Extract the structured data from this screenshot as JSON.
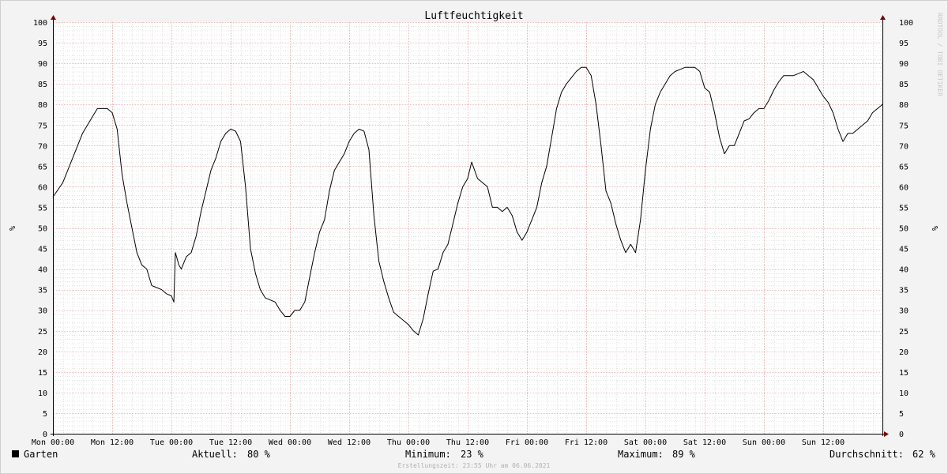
{
  "chart_data": {
    "type": "line",
    "title": "Luftfeuchtigkeit",
    "ylabel": "%",
    "ylim": [
      0,
      100
    ],
    "y_ticks": [
      0,
      5,
      10,
      15,
      20,
      25,
      30,
      35,
      40,
      45,
      50,
      55,
      60,
      65,
      70,
      75,
      80,
      85,
      90,
      95,
      100
    ],
    "x_ticks": [
      "Mon 00:00",
      "Mon 12:00",
      "Tue 00:00",
      "Tue 12:00",
      "Wed 00:00",
      "Wed 12:00",
      "Thu 00:00",
      "Thu 12:00",
      "Fri 00:00",
      "Fri 12:00",
      "Sat 00:00",
      "Sat 12:00",
      "Sun 00:00",
      "Sun 12:00"
    ],
    "x_unit": "hours since Mon 00:00",
    "xlim": [
      0,
      168
    ],
    "grid": true,
    "watermark": "RRDTOOL / TOBI OETIKER",
    "series": [
      {
        "name": "Garten",
        "color": "#000000",
        "points": [
          [
            0,
            57.5
          ],
          [
            2,
            61
          ],
          [
            4,
            67
          ],
          [
            6,
            73
          ],
          [
            8,
            77
          ],
          [
            9,
            79
          ],
          [
            10,
            79
          ],
          [
            11,
            79
          ],
          [
            12,
            78
          ],
          [
            13,
            74
          ],
          [
            14,
            63
          ],
          [
            15,
            56
          ],
          [
            16,
            50
          ],
          [
            17,
            44
          ],
          [
            18,
            41
          ],
          [
            19,
            40
          ],
          [
            20,
            36
          ],
          [
            21,
            35.5
          ],
          [
            22,
            35
          ],
          [
            23,
            34
          ],
          [
            24,
            33.5
          ],
          [
            24.5,
            32
          ],
          [
            24.8,
            44
          ],
          [
            25.5,
            41
          ],
          [
            26,
            40
          ],
          [
            27,
            43
          ],
          [
            28,
            44
          ],
          [
            29,
            48
          ],
          [
            30,
            54
          ],
          [
            31,
            59
          ],
          [
            32,
            64
          ],
          [
            33,
            67
          ],
          [
            34,
            71
          ],
          [
            35,
            73
          ],
          [
            36,
            74
          ],
          [
            37,
            73.5
          ],
          [
            38,
            71
          ],
          [
            39,
            60
          ],
          [
            40,
            45
          ],
          [
            41,
            39
          ],
          [
            42,
            35
          ],
          [
            43,
            33
          ],
          [
            44,
            32.5
          ],
          [
            45,
            32
          ],
          [
            46,
            30
          ],
          [
            47,
            28.5
          ],
          [
            48,
            28.5
          ],
          [
            49,
            30
          ],
          [
            50,
            30
          ],
          [
            51,
            32
          ],
          [
            52,
            38
          ],
          [
            53,
            44
          ],
          [
            54,
            49
          ],
          [
            55,
            52
          ],
          [
            56,
            59
          ],
          [
            57,
            64
          ],
          [
            58,
            66
          ],
          [
            59,
            68
          ],
          [
            60,
            71
          ],
          [
            61,
            73
          ],
          [
            62,
            74
          ],
          [
            63,
            73.5
          ],
          [
            64,
            69
          ],
          [
            65,
            53
          ],
          [
            66,
            42
          ],
          [
            67,
            37
          ],
          [
            68,
            33
          ],
          [
            69,
            29.5
          ],
          [
            70,
            28.5
          ],
          [
            71,
            27.5
          ],
          [
            72,
            26.5
          ],
          [
            73,
            25
          ],
          [
            74,
            24
          ],
          [
            75,
            28
          ],
          [
            76,
            34
          ],
          [
            77,
            39.5
          ],
          [
            78,
            40
          ],
          [
            79,
            44
          ],
          [
            80,
            46
          ],
          [
            81,
            51
          ],
          [
            82,
            56
          ],
          [
            83,
            60
          ],
          [
            84,
            62
          ],
          [
            84.8,
            66
          ],
          [
            86,
            62
          ],
          [
            88,
            60
          ],
          [
            89,
            55
          ],
          [
            90,
            55
          ],
          [
            91,
            54
          ],
          [
            92,
            55
          ],
          [
            93,
            53
          ],
          [
            94,
            49
          ],
          [
            95,
            47
          ],
          [
            96,
            49
          ],
          [
            97,
            52
          ],
          [
            98,
            55
          ],
          [
            99,
            61
          ],
          [
            100,
            65
          ],
          [
            101,
            72
          ],
          [
            102,
            79
          ],
          [
            103,
            83
          ],
          [
            104,
            85
          ],
          [
            105,
            86.5
          ],
          [
            106,
            88
          ],
          [
            107,
            89
          ],
          [
            108,
            89
          ],
          [
            109,
            87
          ],
          [
            110,
            80
          ],
          [
            111,
            70
          ],
          [
            112,
            59
          ],
          [
            113,
            56
          ],
          [
            114,
            51
          ],
          [
            115,
            47
          ],
          [
            116,
            44
          ],
          [
            117,
            46
          ],
          [
            118,
            44
          ],
          [
            119,
            52
          ],
          [
            120,
            64
          ],
          [
            121,
            74
          ],
          [
            122,
            80
          ],
          [
            123,
            83
          ],
          [
            124,
            85
          ],
          [
            125,
            87
          ],
          [
            126,
            88
          ],
          [
            127,
            88.5
          ],
          [
            128,
            89
          ],
          [
            129,
            89
          ],
          [
            130,
            89
          ],
          [
            131,
            88
          ],
          [
            132,
            84
          ],
          [
            133,
            83
          ],
          [
            134,
            78
          ],
          [
            135,
            72
          ],
          [
            136,
            68
          ],
          [
            137,
            70
          ],
          [
            138,
            70
          ],
          [
            139,
            73
          ],
          [
            140,
            76
          ],
          [
            141,
            76.5
          ],
          [
            142,
            78
          ],
          [
            143,
            79
          ],
          [
            144,
            79
          ],
          [
            145,
            81
          ],
          [
            146,
            83.5
          ],
          [
            147,
            85.5
          ],
          [
            148,
            87
          ],
          [
            149,
            87
          ],
          [
            150,
            87
          ],
          [
            151,
            87.5
          ],
          [
            152,
            88
          ],
          [
            153,
            87
          ],
          [
            154,
            86
          ],
          [
            155,
            84
          ],
          [
            156,
            82
          ],
          [
            157,
            80.5
          ],
          [
            158,
            78
          ],
          [
            159,
            74
          ],
          [
            160,
            71
          ],
          [
            161,
            73
          ],
          [
            162,
            73
          ],
          [
            163,
            74
          ],
          [
            164,
            75
          ],
          [
            165,
            76
          ],
          [
            166,
            78
          ],
          [
            167,
            79
          ],
          [
            168,
            80
          ]
        ]
      }
    ]
  },
  "legend": {
    "series_label": "Garten",
    "current_label": "Aktuell:",
    "current_value": "80 %",
    "min_label": "Minimum:",
    "min_value": "23 %",
    "max_label": "Maximum:",
    "max_value": "89 %",
    "avg_label": "Durchschnitt:",
    "avg_value": "62 %"
  },
  "footer": "Erstellungszeit: 23:55 Uhr am 06.06.2021",
  "colors": {
    "background": "#f3f3f3",
    "plot_background": "#ffffff",
    "major_grid": "#e8a6a6",
    "minor_grid": "#cfcfcf",
    "axis": "#7a0000",
    "line": "#000000"
  }
}
